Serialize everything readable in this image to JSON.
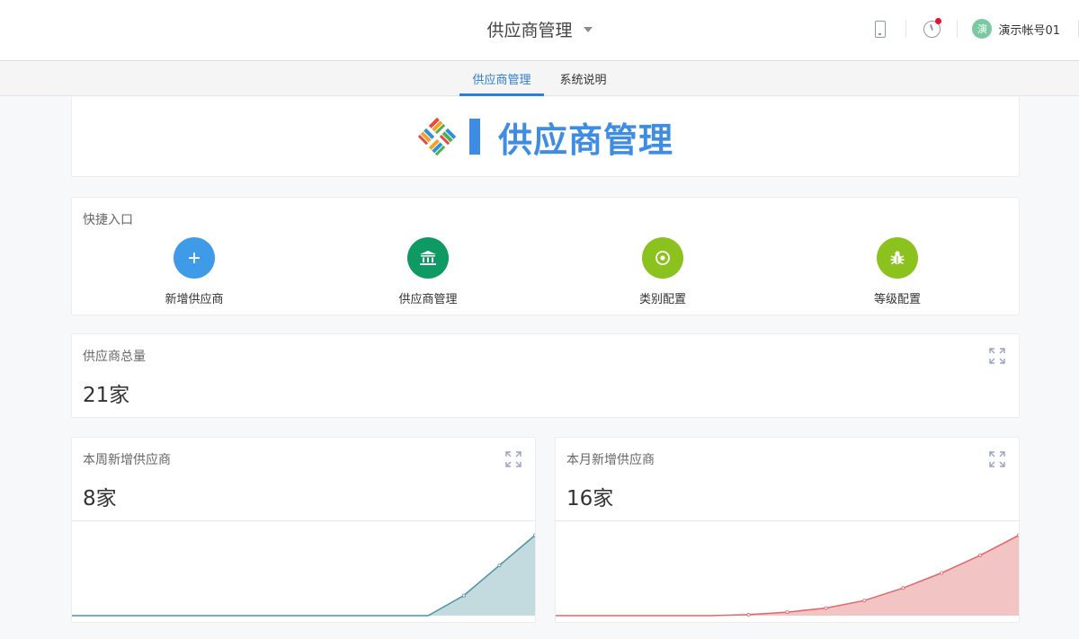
{
  "header": {
    "app_title": "供应商管理",
    "user_avatar": "演",
    "user_name": "演示帐号01",
    "icons": [
      "mobile-icon",
      "support-icon",
      "chevron-down-icon"
    ],
    "notification_color": "#e8102c"
  },
  "tabs": [
    {
      "label": "供应商管理",
      "active": true
    },
    {
      "label": "系统说明",
      "active": false
    }
  ],
  "banner": {
    "title": "供应商管理",
    "accent_color": "#3f8de0"
  },
  "quick_entry": {
    "title": "快捷入口",
    "items": [
      {
        "label": "新增供应商",
        "icon": "plus-icon",
        "color": "#3f9ae8"
      },
      {
        "label": "供应商管理",
        "icon": "bank-icon",
        "color": "#109a63"
      },
      {
        "label": "类别配置",
        "icon": "target-icon",
        "color": "#8cc21e"
      },
      {
        "label": "等级配置",
        "icon": "bug-icon",
        "color": "#8cc21e"
      }
    ]
  },
  "stats": {
    "total": {
      "title": "供应商总量",
      "value": "21家"
    },
    "week": {
      "title": "本周新增供应商",
      "value": "8家",
      "color": "#4a93a3",
      "fill": "#c3dade"
    },
    "month": {
      "title": "本月新增供应商",
      "value": "16家",
      "color": "#e0676a",
      "fill": "#f3c4c4"
    }
  },
  "chart_data": [
    {
      "type": "area",
      "series": [
        {
          "values": [
            0,
            0,
            0,
            0,
            0,
            0,
            0,
            0,
            0,
            0,
            0,
            2,
            5,
            8
          ]
        }
      ],
      "ylim": [
        0,
        8.5
      ]
    },
    {
      "type": "area",
      "series": [
        {
          "values": [
            0,
            0,
            0,
            0,
            0,
            0.2,
            0.7,
            1.5,
            3,
            5.5,
            8.5,
            12,
            16
          ]
        }
      ],
      "ylim": [
        0,
        17
      ]
    }
  ]
}
